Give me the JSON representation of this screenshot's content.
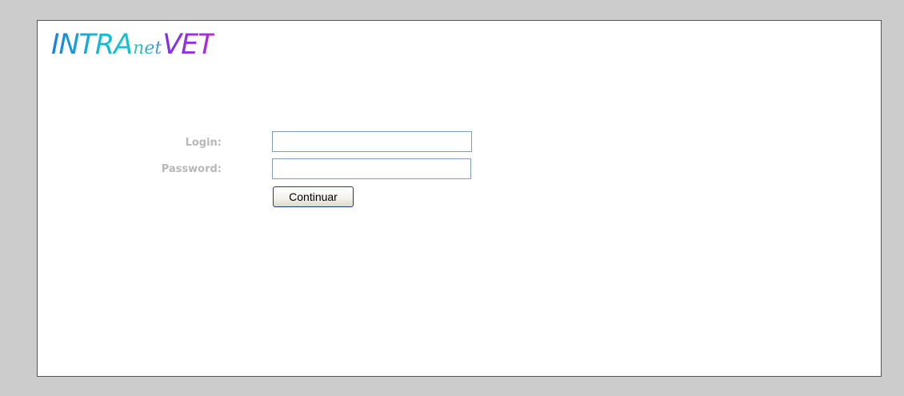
{
  "logo": {
    "part1": "INTRA",
    "part2": "net",
    "part3": "VET"
  },
  "form": {
    "login_label": "Login:",
    "login_value": "",
    "password_label": "Password:",
    "password_value": "",
    "submit_label": "Continuar"
  },
  "colors": {
    "page_background": "#cccccc",
    "panel_background": "#ffffff",
    "label_text": "#b8b8b8",
    "input_border": "#7f9db9",
    "logo_intra": "#1a7fe0",
    "logo_net": "#2ec7a6",
    "logo_vet": "#9b2fe0"
  }
}
